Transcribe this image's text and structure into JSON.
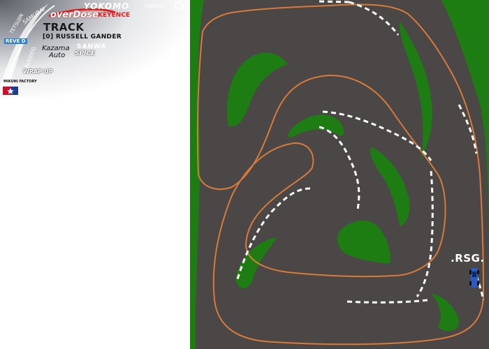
{
  "hud": {
    "track_title": "TRACK",
    "driver": "[0]  RUSSELL GANDER",
    "sponsors": {
      "samurai": "SAMURAI",
      "overdose": "overDose",
      "keyence": "KEYENCE",
      "yokomo": "YOKOMO",
      "topline": "topline",
      "sanwa": "SANWA",
      "kazama": "Kazama",
      "auto": "Auto",
      "spice": "SPICE",
      "wrap_up": "WRAP-UP",
      "mikuni": "MIKUNI FACTORY",
      "reve": "REVE D",
      "ruddog": "RUDDOG",
      "tetsujin": "TETSUJIN"
    }
  },
  "map": {
    "badge": ".RSG."
  },
  "colors": {
    "grass": "#1e7d12",
    "asphalt": "#4a4746",
    "racing_line": "#d87a3a",
    "kerb_dash": "#ffffff",
    "car": "#2a5cc8"
  }
}
